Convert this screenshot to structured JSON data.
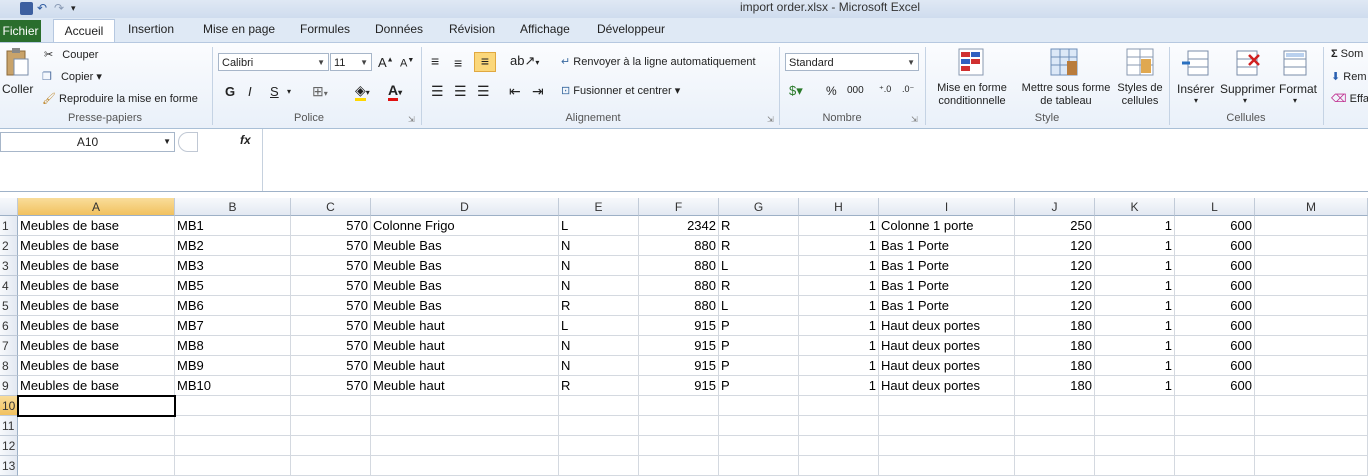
{
  "window": {
    "title": "import order.xlsx - Microsoft Excel"
  },
  "tabs": [
    {
      "label": "Fichier"
    },
    {
      "label": "Accueil"
    },
    {
      "label": "Insertion"
    },
    {
      "label": "Mise en page"
    },
    {
      "label": "Formules"
    },
    {
      "label": "Données"
    },
    {
      "label": "Révision"
    },
    {
      "label": "Affichage"
    },
    {
      "label": "Développeur"
    }
  ],
  "ribbon": {
    "clipboard": {
      "paste": "Coller",
      "cut": "Couper",
      "copy": "Copier",
      "format_painter": "Reproduire la mise en forme",
      "label": "Presse-papiers"
    },
    "font": {
      "name": "Calibri",
      "size": "11",
      "bold": "G",
      "italic": "I",
      "underline": "S",
      "label": "Police"
    },
    "alignment": {
      "wrap": "Renvoyer à la ligne automatiquement",
      "merge": "Fusionner et centrer",
      "label": "Alignement"
    },
    "number": {
      "format": "Standard",
      "label": "Nombre"
    },
    "style": {
      "conditional": "Mise en forme conditionnelle",
      "table": "Mettre sous forme de tableau",
      "cell_styles": "Styles de cellules",
      "label": "Style"
    },
    "cells": {
      "insert": "Insérer",
      "delete": "Supprimer",
      "format": "Format",
      "label": "Cellules"
    },
    "editing": {
      "sum": "Som",
      "fill": "Rem",
      "clear": "Effa"
    }
  },
  "formula_bar": {
    "name_box": "A10",
    "fx": "fx",
    "value": ""
  },
  "sheet": {
    "columns": [
      "A",
      "B",
      "C",
      "D",
      "E",
      "F",
      "G",
      "H",
      "I",
      "J",
      "K",
      "L",
      "M"
    ],
    "rows": [
      "1",
      "2",
      "3",
      "4",
      "5",
      "6",
      "7",
      "8",
      "9",
      "10",
      "11",
      "12",
      "13"
    ],
    "data": [
      [
        "Meubles de base",
        "MB1",
        "570",
        "Colonne Frigo",
        "L",
        "2342",
        "R",
        "1",
        "Colonne 1 porte",
        "250",
        "1",
        "600"
      ],
      [
        "Meubles de base",
        "MB2",
        "570",
        "Meuble Bas",
        "N",
        "880",
        "R",
        "1",
        "Bas 1 Porte",
        "120",
        "1",
        "600"
      ],
      [
        "Meubles de base",
        "MB3",
        "570",
        "Meuble Bas",
        "N",
        "880",
        "L",
        "1",
        "Bas 1 Porte",
        "120",
        "1",
        "600"
      ],
      [
        "Meubles de base",
        "MB5",
        "570",
        "Meuble Bas",
        "N",
        "880",
        "R",
        "1",
        "Bas 1 Porte",
        "120",
        "1",
        "600"
      ],
      [
        "Meubles de base",
        "MB6",
        "570",
        "Meuble Bas",
        "R",
        "880",
        "L",
        "1",
        "Bas 1 Porte",
        "120",
        "1",
        "600"
      ],
      [
        "Meubles de base",
        "MB7",
        "570",
        "Meuble haut",
        "L",
        "915",
        "P",
        "1",
        "Haut deux portes",
        "180",
        "1",
        "600"
      ],
      [
        "Meubles de base",
        "MB8",
        "570",
        "Meuble haut",
        "N",
        "915",
        "P",
        "1",
        "Haut deux portes",
        "180",
        "1",
        "600"
      ],
      [
        "Meubles de base",
        "MB9",
        "570",
        "Meuble haut",
        "N",
        "915",
        "P",
        "1",
        "Haut deux portes",
        "180",
        "1",
        "600"
      ],
      [
        "Meubles de base",
        "MB10",
        "570",
        "Meuble haut",
        "R",
        "915",
        "P",
        "1",
        "Haut deux portes",
        "180",
        "1",
        "600"
      ]
    ],
    "active_cell": "A10"
  }
}
